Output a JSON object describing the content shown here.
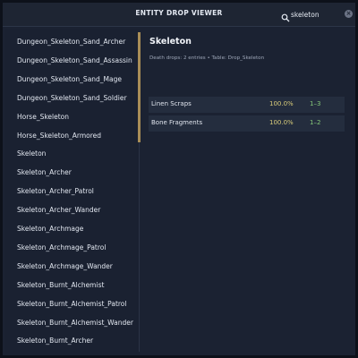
{
  "window": {
    "title": "ENTITY DROP VIEWER"
  },
  "search": {
    "value": "skeleton",
    "clear_label": "×"
  },
  "sidebar": {
    "items": [
      "Dungeon_Skeleton_Sand_Archer",
      "Dungeon_Skeleton_Sand_Assassin",
      "Dungeon_Skeleton_Sand_Mage",
      "Dungeon_Skeleton_Sand_Soldier",
      "Horse_Skeleton",
      "Horse_Skeleton_Armored",
      "Skeleton",
      "Skeleton_Archer",
      "Skeleton_Archer_Patrol",
      "Skeleton_Archer_Wander",
      "Skeleton_Archmage",
      "Skeleton_Archmage_Patrol",
      "Skeleton_Archmage_Wander",
      "Skeleton_Burnt_Alchemist",
      "Skeleton_Burnt_Alchemist_Patrol",
      "Skeleton_Burnt_Alchemist_Wander",
      "Skeleton_Burnt_Archer"
    ]
  },
  "detail": {
    "title": "Skeleton",
    "subtitle": "Death drops: 2 entries • Table: Drop_Skeleton",
    "drops": [
      {
        "name": "Linen Scraps",
        "chance": "100.0%",
        "qty": "1–3"
      },
      {
        "name": "Bone Fragments",
        "chance": "100.0%",
        "qty": "1–2"
      }
    ]
  },
  "colors": {
    "accent_divider": "#a98e57",
    "chance_text": "#d9cc7a",
    "qty_text": "#86c879"
  }
}
